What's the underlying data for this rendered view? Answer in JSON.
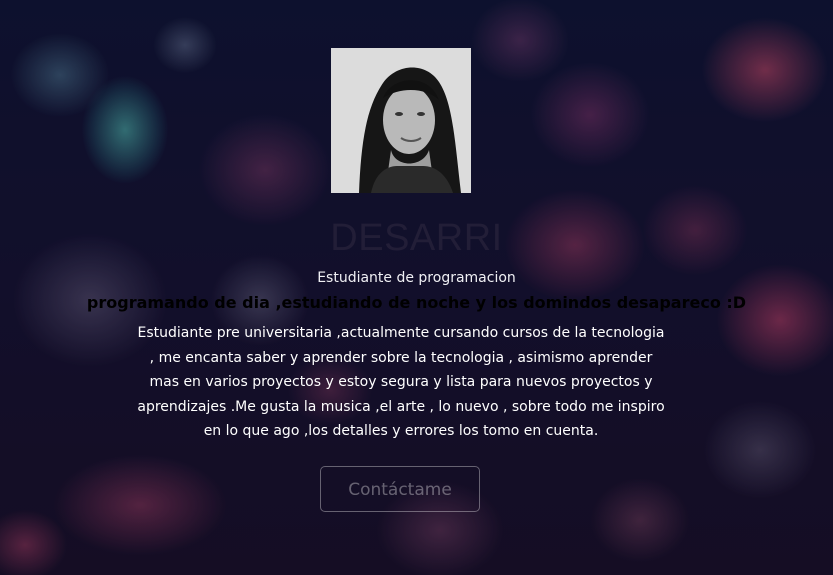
{
  "profile": {
    "name": "DESARRI",
    "role": "Estudiante de programacion",
    "tagline": "programando de dia ,estudiando de noche y los domindos desapareco :D",
    "bio": "Estudiante pre universitaria ,actualmente cursando cursos de la tecnologia , me encanta saber y aprender sobre la tecnologia , asimismo aprender mas en varios proyectos y estoy segura y lista para nuevos proyectos y aprendizajes .Me gusta la musica ,el arte , lo nuevo , sobre todo me inspiro en lo que ago ,los detalles y errores los tomo en cuenta.",
    "photo_icon": "profile-photo"
  },
  "actions": {
    "contact_label": "Contáctame"
  },
  "colors": {
    "background": "#0b1027",
    "accent_pink": "#d94a72",
    "accent_teal": "#4fd1c0"
  }
}
